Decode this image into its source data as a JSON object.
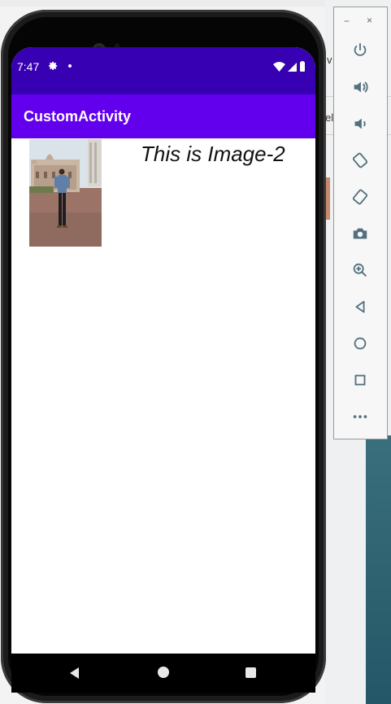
{
  "status_bar": {
    "time": "7:47"
  },
  "app_bar": {
    "title": "CustomActivity"
  },
  "content": {
    "caption": "This is Image-2"
  },
  "emulator": {
    "minimize": "−",
    "close": "×",
    "controls": [
      "power-icon",
      "volume-up-icon",
      "volume-down-icon",
      "rotate-left-icon",
      "rotate-right-icon",
      "camera-icon",
      "zoom-icon",
      "back-icon",
      "home-icon",
      "overview-icon",
      "more-icon"
    ]
  },
  "background": {
    "side_text": [
      "v",
      "el"
    ]
  },
  "colors": {
    "status_bar": "#3700b3",
    "app_bar": "#6200ee",
    "screen": "#ffffff"
  }
}
